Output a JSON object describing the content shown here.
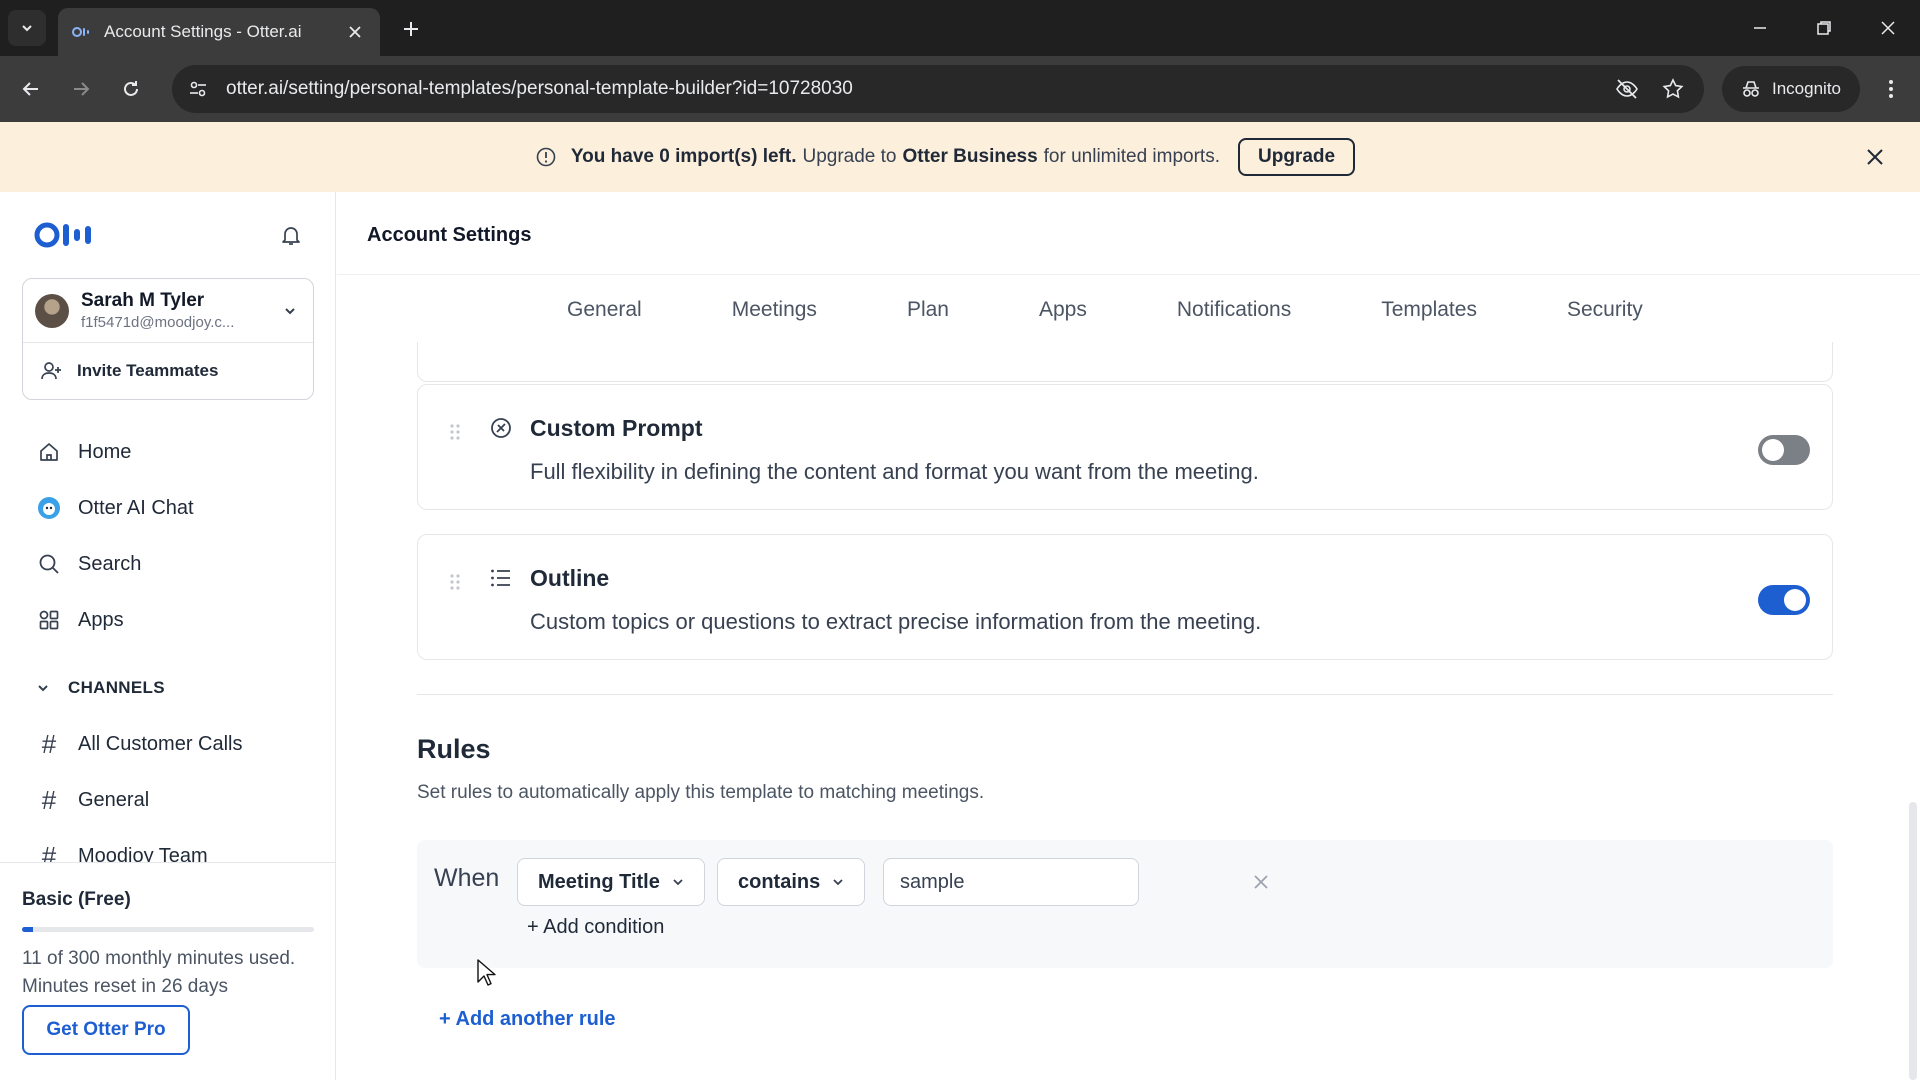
{
  "browser": {
    "tab_title": "Account Settings - Otter.ai",
    "url": "otter.ai/setting/personal-templates/personal-template-builder?id=10728030",
    "incognito_label": "Incognito"
  },
  "banner": {
    "strong_text": "You have 0 import(s) left.",
    "text_before": "Upgrade to",
    "brand": "Otter Business",
    "text_after": "for unlimited imports.",
    "upgrade_label": "Upgrade"
  },
  "sidebar": {
    "user": {
      "name": "Sarah M Tyler",
      "email": "f1f5471d@moodjoy.c..."
    },
    "invite_label": "Invite Teammates",
    "nav": [
      {
        "label": "Home",
        "icon": "home-icon"
      },
      {
        "label": "Otter AI Chat",
        "icon": "otter-chat-icon"
      },
      {
        "label": "Search",
        "icon": "search-icon"
      },
      {
        "label": "Apps",
        "icon": "apps-icon"
      }
    ],
    "channels_heading": "CHANNELS",
    "channels": [
      {
        "label": "All Customer Calls"
      },
      {
        "label": "General"
      },
      {
        "label": "Moodjoy Team"
      }
    ],
    "plan": {
      "name": "Basic (Free)",
      "usage_line1": "11 of 300 monthly minutes used.",
      "usage_line2": "Minutes reset in 26 days",
      "used_minutes": 11,
      "total_minutes": 300,
      "cta": "Get Otter Pro"
    }
  },
  "main": {
    "title": "Account Settings",
    "tabs": [
      {
        "label": "General"
      },
      {
        "label": "Meetings"
      },
      {
        "label": "Plan"
      },
      {
        "label": "Apps"
      },
      {
        "label": "Notifications"
      },
      {
        "label": "Templates"
      },
      {
        "label": "Security"
      }
    ],
    "features": [
      {
        "title": "Custom Prompt",
        "description": "Full flexibility in defining the content and format you want from the meeting.",
        "enabled": false
      },
      {
        "title": "Outline",
        "description": "Custom topics or questions to extract precise information from the meeting.",
        "enabled": true
      }
    ],
    "rules": {
      "title": "Rules",
      "description": "Set rules to automatically apply this template to matching meetings.",
      "when_label": "When",
      "field": "Meeting Title",
      "operator": "contains",
      "value": "sample",
      "add_condition": "+ Add condition",
      "add_rule": "+ Add another rule"
    }
  },
  "colors": {
    "accent": "#1d5fd1",
    "banner_bg": "#fcefdc",
    "toggle_off": "#7b7f86"
  }
}
